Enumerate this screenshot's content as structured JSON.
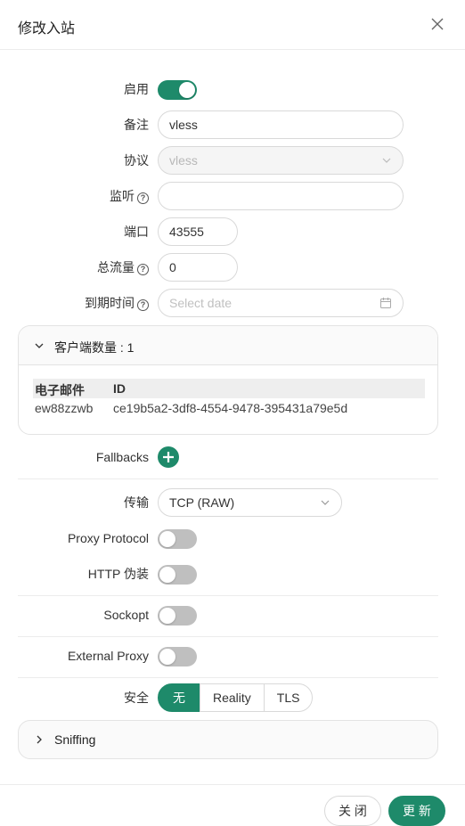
{
  "dialog": {
    "title": "修改入站"
  },
  "form": {
    "enable": {
      "label": "启用",
      "on": true
    },
    "remark": {
      "label": "备注",
      "value": "vless"
    },
    "protocol": {
      "label": "协议",
      "value": "vless"
    },
    "listen": {
      "label": "监听",
      "value": ""
    },
    "port": {
      "label": "端口",
      "value": "43555"
    },
    "total_traffic": {
      "label": "总流量",
      "value": "0"
    },
    "expiry": {
      "label": "到期时间",
      "placeholder": "Select date"
    }
  },
  "clients": {
    "title": "客户端数量 : 1",
    "columns": [
      "电子邮件",
      "ID"
    ],
    "rows": [
      [
        "ew88zzwb",
        "ce19b5a2-3df8-4554-9478-395431a79e5d"
      ]
    ]
  },
  "fallbacks": {
    "label": "Fallbacks"
  },
  "transport": {
    "label": "传输",
    "value": "TCP (RAW)"
  },
  "proxy_protocol": {
    "label": "Proxy Protocol",
    "on": false
  },
  "http_camouflage": {
    "label": "HTTP 伪装",
    "on": false
  },
  "sockopt": {
    "label": "Sockopt",
    "on": false
  },
  "external_proxy": {
    "label": "External Proxy",
    "on": false
  },
  "security": {
    "label": "安全",
    "options": [
      "无",
      "Reality",
      "TLS"
    ],
    "selected": "无"
  },
  "sniffing": {
    "label": "Sniffing"
  },
  "footer": {
    "close_label": "关 闭",
    "update_label": "更 新"
  },
  "colors": {
    "accent": "#1e8a6a",
    "toggle_off": "#bfbfbf",
    "border": "#d9d9d9"
  }
}
